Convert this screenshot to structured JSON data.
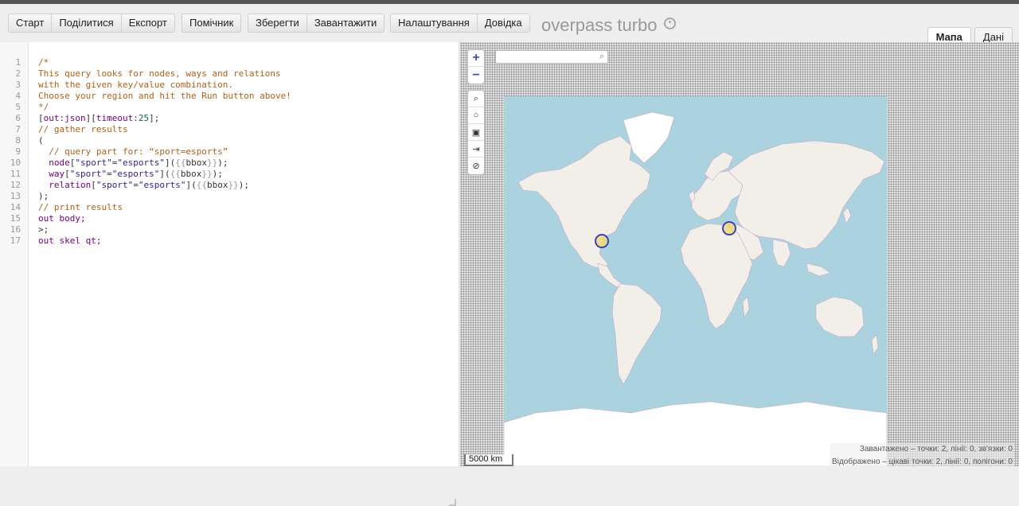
{
  "toolbar": {
    "run": "Старт",
    "share": "Поділитися",
    "export": "Експорт",
    "wizard": "Помічник",
    "save": "Зберегти",
    "load": "Завантажити",
    "settings": "Налаштування",
    "help": "Довідка",
    "logo": "overpass turbo"
  },
  "tabs": {
    "map": "Мапа",
    "data": "Дані"
  },
  "editor": {
    "line_numbers": [
      "1",
      "2",
      "3",
      "4",
      "5",
      "6",
      "7",
      "8",
      "9",
      "10",
      "11",
      "12",
      "13",
      "14",
      "15",
      "16",
      "17"
    ],
    "l1": "/*",
    "l2": "This query looks for nodes, ways and relations",
    "l3": "with the given key/value combination.",
    "l4": "Choose your region and hit the Run button above!",
    "l5": "*/",
    "l6": {
      "a": "[",
      "b": "out",
      "c": ":",
      "d": "json",
      "e": "][",
      "f": "timeout",
      "g": ":",
      "h": "25",
      "i": "];"
    },
    "l7": "// gather results",
    "l8": "(",
    "l9": "  // query part for: “sport=esports”",
    "l10": {
      "indent": "  ",
      "kw": "node",
      "a": "[",
      "k": "\"sport\"",
      "eq": "=",
      "v": "\"esports\"",
      "b": "](",
      "br": "{{",
      "bbox": "bbox",
      "br2": "}}",
      "c": ");"
    },
    "l11": {
      "indent": "  ",
      "kw": "way",
      "a": "[",
      "k": "\"sport\"",
      "eq": "=",
      "v": "\"esports\"",
      "b": "](",
      "br": "{{",
      "bbox": "bbox",
      "br2": "}}",
      "c": ");"
    },
    "l12": {
      "indent": "  ",
      "kw": "relation",
      "a": "[",
      "k": "\"sport\"",
      "eq": "=",
      "v": "\"esports\"",
      "b": "](",
      "br": "{{",
      "bbox": "bbox",
      "br2": "}}",
      "c": ");"
    },
    "l13": ");",
    "l14": "// print results",
    "l15": "out body;",
    "l16": ">;",
    "l17": "out skel qt;"
  },
  "map": {
    "zoom_in": "+",
    "zoom_out": "−",
    "scale": "5000 km",
    "stats_loaded": "Завантажено – точки: 2, лінії: 0, зв'язки: 0",
    "stats_displayed": "Відображено – цікаві точки: 2, лінії: 0, полігони: 0",
    "colors": {
      "water": "#aad3df",
      "land": "#f2efe9",
      "ice": "#ffffff",
      "marker_fill": "#f0d97a",
      "marker_stroke": "#3344cc"
    }
  }
}
